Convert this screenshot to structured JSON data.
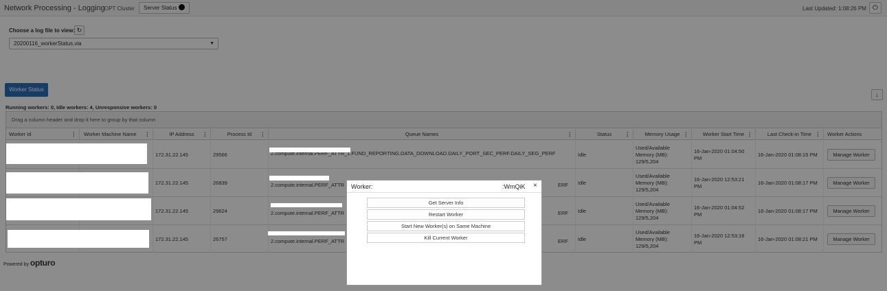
{
  "header": {
    "title": "Network Processing - Logging",
    "cluster": "OPT Cluster",
    "server_status_label": "Server Status",
    "last_updated": "Last Updated: 1:08:26 PM",
    "power_icon": "power-icon"
  },
  "log_selector": {
    "label": "Choose a log file to view:",
    "selected": "20200116_workerStatus.via",
    "refresh_icon": "refresh-icon"
  },
  "worker_status_button": "Worker Status",
  "summary": "Running workers: 0, Idle workers: 4, Unresponsive workers: 0",
  "grid": {
    "group_hint": "Drag a column header and drop it here to group by that column",
    "columns": [
      "Worker Id",
      "Worker Machine Name",
      "IP Address",
      "Process Id",
      "Queue Names",
      "Status",
      "Memory Usage",
      "Worker Start Time",
      "Last Check-in Time",
      "Worker Actions"
    ],
    "rows": [
      {
        "ip": "172.31.22.145",
        "pid": "29566",
        "queue": "2.compute.internal.PERF_ATTR_1.FUND_REPORTING.DATA_DOWNLOAD.DAILY_PORT_SEC_PERF.DAILY_SEG_PERF",
        "status": "Idle",
        "memory": "Used/Available Memory (MB): 129/5,204",
        "start": "16-Jan-2020 01:04:50 PM",
        "checkin": "16-Jan-2020 01:08:15 PM",
        "action": "Manage Worker"
      },
      {
        "ip": "172.31.22.145",
        "pid": "26839",
        "queue": "2.compute.internal.PERF_ATTR",
        "queue_tail": "ERF",
        "status": "Idle",
        "memory": "Used/Available Memory (MB): 129/5,204",
        "start": "16-Jan-2020 12:53:21 PM",
        "checkin": "16-Jan-2020 01:08:17 PM",
        "action": "Manage Worker"
      },
      {
        "ip": "172.31.22.145",
        "pid": "29624",
        "queue": "2.compute.internal.PERF_ATTR",
        "queue_tail": "ERF",
        "status": "Idle",
        "memory": "Used/Available Memory (MB): 129/5,204",
        "start": "16-Jan-2020 01:04:52 PM",
        "checkin": "16-Jan-2020 01:08:17 PM",
        "action": "Manage Worker"
      },
      {
        "ip": "172.31.22.145",
        "pid": "26757",
        "queue": "2.compute.internal.PERF_ATTR",
        "queue_tail": "ERF",
        "status": "Idle",
        "memory": "Used/Available Memory (MB): 129/5,204",
        "start": "16-Jan-2020 12:53:16 PM",
        "checkin": "16-Jan-2020 01:08:21 PM",
        "action": "Manage Worker"
      }
    ]
  },
  "footer": {
    "powered_by": "Powered by",
    "brand": "opturo"
  },
  "modal": {
    "title_prefix": "Worker:",
    "title_suffix": ":WmQiK",
    "close": "×",
    "actions": [
      "Get Server Info",
      "Restart Worker",
      "Start New Worker(s) on Same Machine",
      "Kill Current Worker"
    ]
  }
}
